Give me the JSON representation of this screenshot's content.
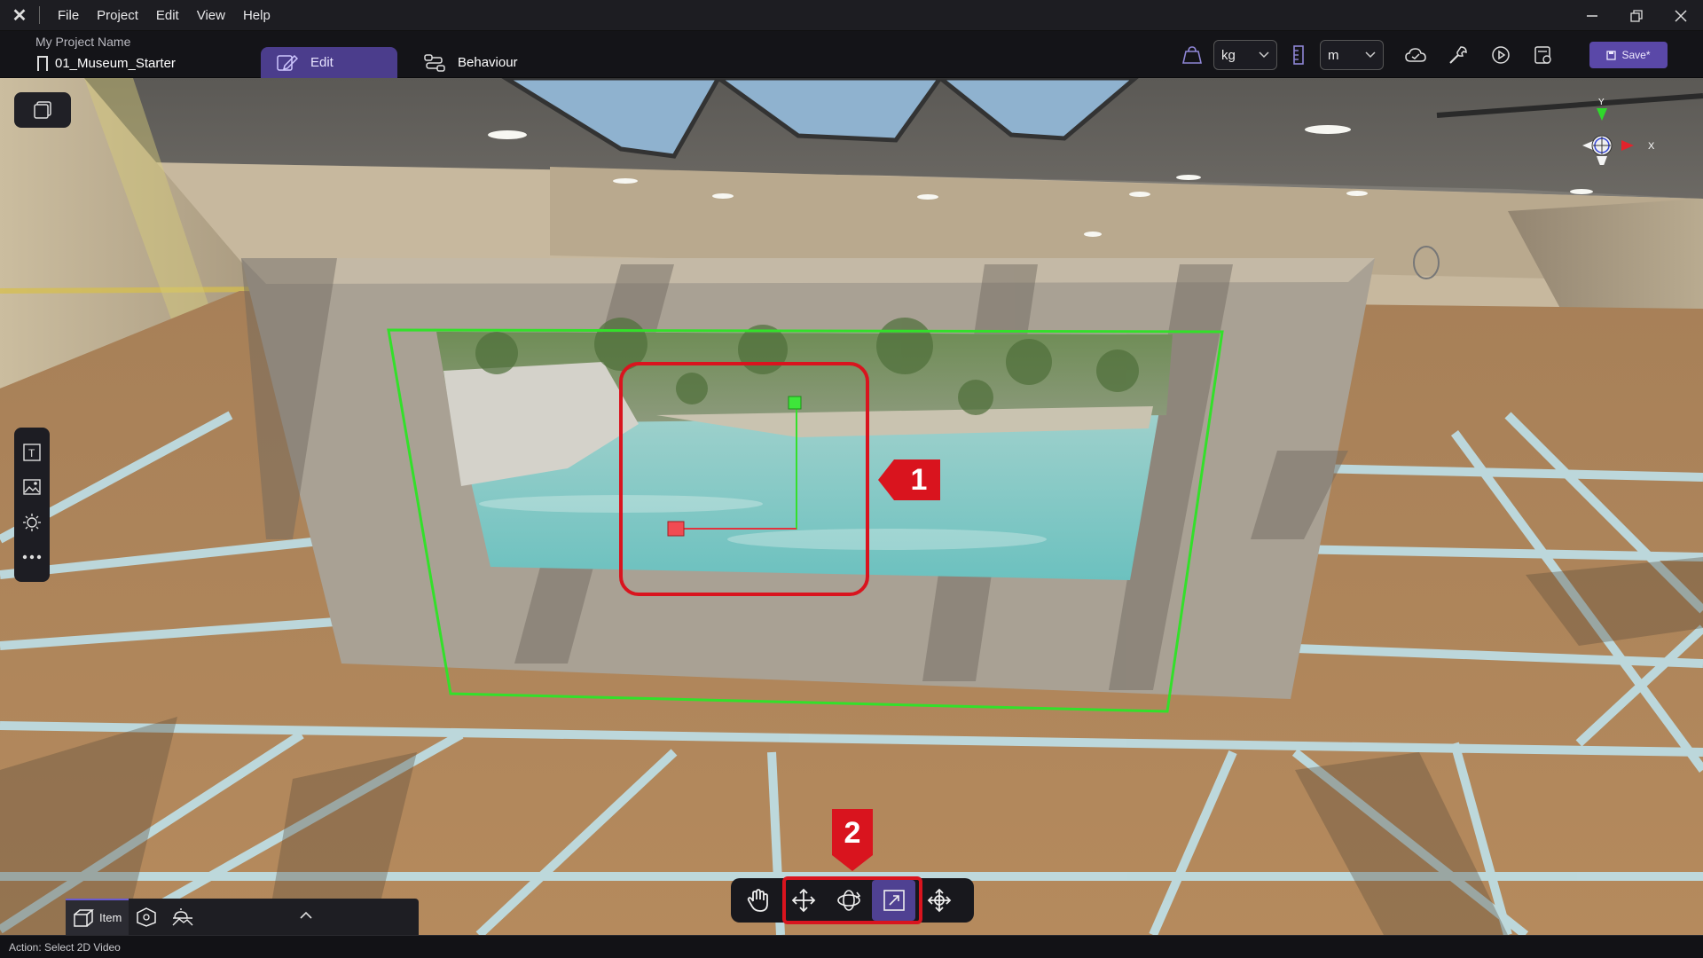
{
  "menu": {
    "items": [
      "File",
      "Project",
      "Edit",
      "View",
      "Help"
    ]
  },
  "header": {
    "project_name": "My Project Name",
    "file_name": "01_Museum_Starter",
    "tabs": {
      "edit": "Edit",
      "behaviour": "Behaviour"
    },
    "mass_unit": "kg",
    "length_unit": "m",
    "save_label": "Save*"
  },
  "gizmo": {
    "y_label": "Y",
    "x_label": "X"
  },
  "bottom_tabs": {
    "item_label": "Item"
  },
  "annotations": {
    "label_1": "1",
    "label_2": "2"
  },
  "status": {
    "action_text": "Action: Select 2D Video"
  },
  "colors": {
    "accent": "#4f4192",
    "annotation": "#d9141e",
    "selection": "#33e02a"
  }
}
